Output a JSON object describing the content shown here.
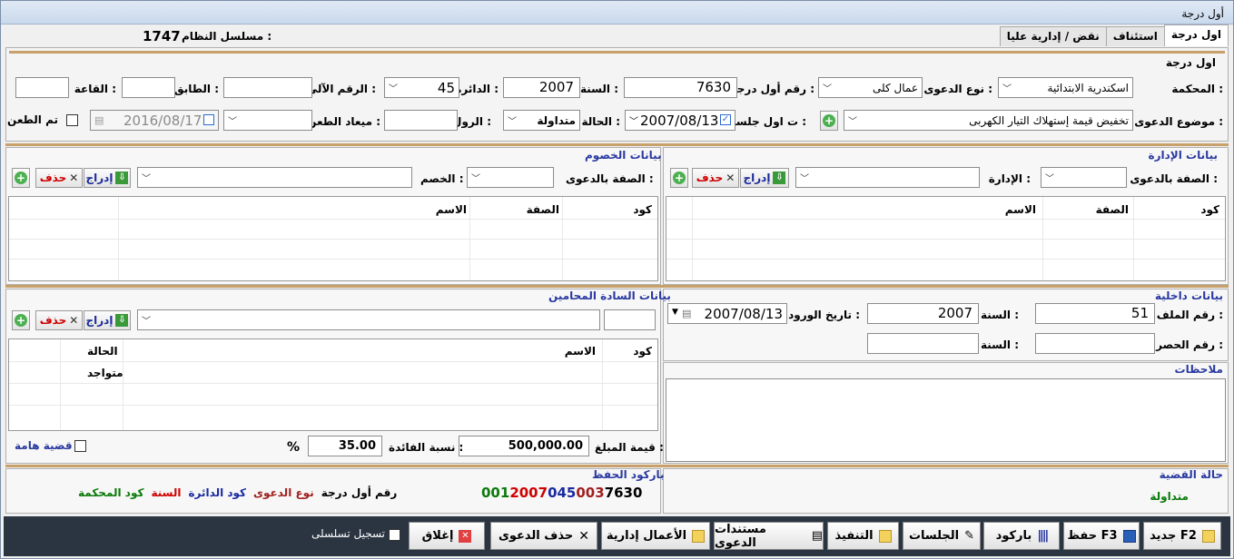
{
  "window": {
    "title": "أول درجة"
  },
  "tabs": [
    "اول درجة",
    "استئناف",
    "نقض / إدارية عليا"
  ],
  "serial": {
    "label": "مسلسل النظام :",
    "value": "1747"
  },
  "first_degree": {
    "title": "اول درجة",
    "court_label": "المحكمة :",
    "court_value": "اسكندرية الابتدائية",
    "case_type_label": "نوع الدعوى :",
    "case_type_value": "عمال كلى",
    "case_no_label": "رقم أول درجة :",
    "case_no_value": "7630",
    "year_label": "السنة :",
    "year_value": "2007",
    "circuit_label": "الدائرة :",
    "circuit_value": "45",
    "auto_no_label": "الرقم الآلى :",
    "auto_no_value": "",
    "floor_label": "الطابق :",
    "floor_value": "",
    "hall_label": "القاعة :",
    "hall_value": "",
    "subject_label": "موضوع الدعوى :",
    "subject_value": "تخفيض قيمة إستهلاك التيار الكهربى",
    "first_session_label": "ت اول جلسة :",
    "first_session_value": "2007/08/13",
    "status_label": "الحالة :",
    "status_value": "متداولة",
    "roll_label": "الرول :",
    "roll_value": "",
    "appeal_date_label": "ميعاد الطعن :",
    "appeal_date_value": "",
    "appeal_date2": "2016/08/17",
    "appealed_label": "تم الطعن"
  },
  "admin": {
    "title": "بيانات الإدارة",
    "capacity_label": "الصفة بالدعوى :",
    "capacity_value": "",
    "admin_label": "الإدارة :",
    "admin_value": "",
    "insert": "إدراج",
    "delete": "حذف",
    "columns": [
      "كود",
      "الصفة",
      "الاسم"
    ]
  },
  "opponents": {
    "title": "بيانات الخصوم",
    "capacity_label": "الصفة بالدعوى :",
    "capacity_value": "",
    "opponent_label": "الخصم :",
    "opponent_value": "",
    "insert": "إدراج",
    "delete": "حذف",
    "columns": [
      "كود",
      "الصفة",
      "الاسم"
    ]
  },
  "internal": {
    "title": "بيانات داخلية",
    "file_no_label": "رقم الملف :",
    "file_no_value": "51",
    "year_label": "السنة :",
    "year_value": "2007",
    "arrival_date_label": "تاريخ الورود :",
    "arrival_date_value": "2007/08/13",
    "inventory_no_label": "رقم الحصر :",
    "inventory_no_value": "",
    "year2_label": "السنة :",
    "year2_value": ""
  },
  "notes": {
    "title": "ملاحظات"
  },
  "lawyers": {
    "title": "بيانات السادة المحامين",
    "insert": "إدراج",
    "delete": "حذف",
    "columns": [
      "كود",
      "الاسم",
      "الحالة"
    ],
    "rows": [
      {
        "code": "",
        "name": "",
        "status": "متواجد"
      }
    ],
    "amount_label": "قيمة المبلغ :",
    "amount_value": "500,000.00",
    "interest_label": "نسبة الفائدة :",
    "interest_value": "35.00",
    "percent": "%",
    "important_label": "قضية هامة"
  },
  "case_status": {
    "title": "حالة القضية",
    "value": "متداولة"
  },
  "barcode": {
    "title": "باركود الحفظ",
    "parts": [
      {
        "text": "001",
        "color": "#0a7a0a"
      },
      {
        "text": "2007",
        "color": "#d00000"
      },
      {
        "text": "045",
        "color": "#1a2aa0"
      },
      {
        "text": "003",
        "color": "#a02020"
      },
      {
        "text": "7630",
        "color": "#000000"
      }
    ],
    "legend": [
      {
        "text": "رقم أول درجة",
        "color": "#000000"
      },
      {
        "text": "نوع الدعوى",
        "color": "#a02020"
      },
      {
        "text": "كود الدائرة",
        "color": "#1a2aa0"
      },
      {
        "text": "السنة",
        "color": "#d00000"
      },
      {
        "text": "كود المحكمة",
        "color": "#0a7a0a"
      }
    ]
  },
  "toolbar": {
    "new": "جديد F2",
    "save": "حفظ F3",
    "barcode": "باركود",
    "sessions": "الجلسات",
    "execution": "التنفيذ",
    "documents": "مستندات الدعوى",
    "admin_work": "الأعمال إدارية",
    "delete_case": "حذف الدعوى",
    "close": "إغلاق",
    "serial_record": "تسجيل تسلسلى"
  }
}
